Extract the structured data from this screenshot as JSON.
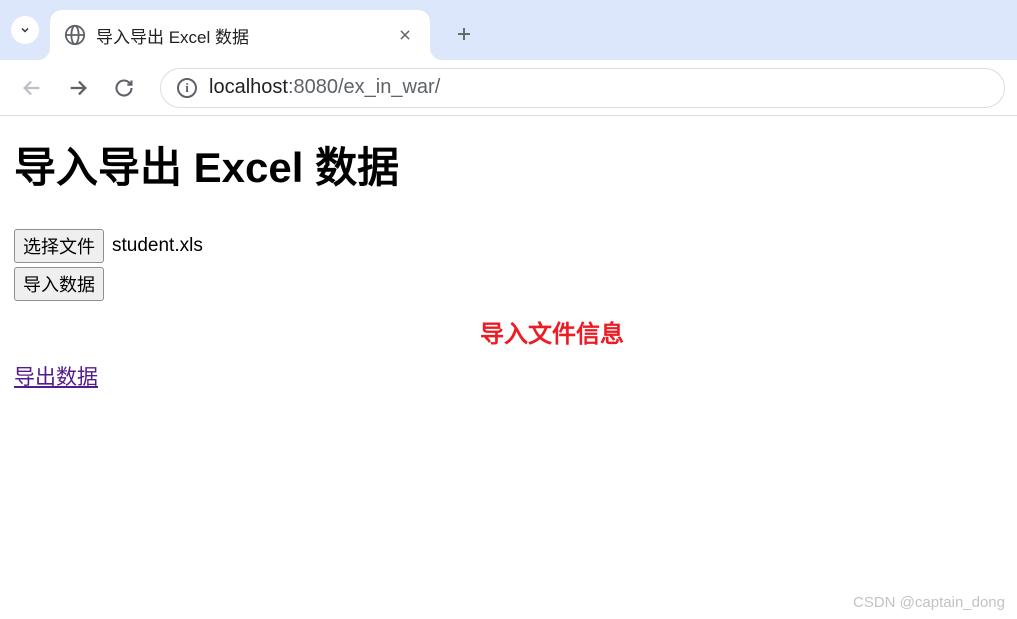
{
  "browser": {
    "tab_title": "导入导出 Excel 数据",
    "url_host": "localhost",
    "url_port": ":8080",
    "url_path": "/ex_in_war/"
  },
  "page": {
    "heading": "导入导出 Excel 数据",
    "choose_file_label": "选择文件",
    "selected_filename": "student.xls",
    "import_button_label": "导入数据",
    "export_link_label": "导出数据"
  },
  "annotation": {
    "text": "导入文件信息"
  },
  "watermark": {
    "text": "CSDN @captain_dong"
  }
}
